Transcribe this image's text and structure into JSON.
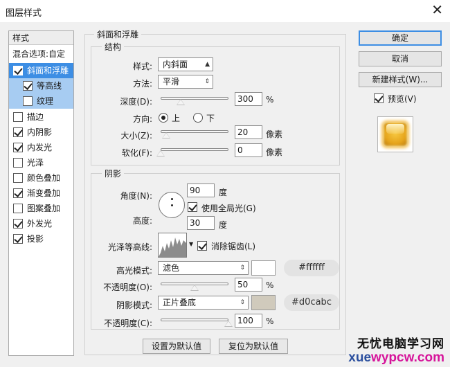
{
  "window": {
    "title": "图层样式",
    "close_glyph": "✕"
  },
  "left_panel": {
    "header": "样式",
    "blend_options": "混合选项:自定",
    "items": [
      {
        "label": "斜面和浮雕",
        "checked": true
      },
      {
        "label": "等高线",
        "checked": true
      },
      {
        "label": "纹理",
        "checked": false
      },
      {
        "label": "描边",
        "checked": false
      },
      {
        "label": "内阴影",
        "checked": true
      },
      {
        "label": "内发光",
        "checked": true
      },
      {
        "label": "光泽",
        "checked": false
      },
      {
        "label": "颜色叠加",
        "checked": false
      },
      {
        "label": "渐变叠加",
        "checked": true
      },
      {
        "label": "图案叠加",
        "checked": false
      },
      {
        "label": "外发光",
        "checked": true
      },
      {
        "label": "投影",
        "checked": true
      }
    ]
  },
  "bevel": {
    "group_title": "斜面和浮雕",
    "structure": {
      "title": "结构",
      "style_label": "样式:",
      "style_value": "内斜面",
      "technique_label": "方法:",
      "technique_value": "平滑",
      "depth_label": "深度(D):",
      "depth_value": "300",
      "depth_unit": "%",
      "direction_label": "方向:",
      "direction_up": "上",
      "direction_down": "下",
      "size_label": "大小(Z):",
      "size_value": "20",
      "size_unit": "像素",
      "soften_label": "软化(F):",
      "soften_value": "0",
      "soften_unit": "像素"
    },
    "shading": {
      "title": "阴影",
      "angle_label": "角度(N):",
      "angle_value": "90",
      "angle_unit": "度",
      "global_light_label": "使用全局光(G)",
      "altitude_label": "高度:",
      "altitude_value": "30",
      "altitude_unit": "度",
      "gloss_contour_label": "光泽等高线:",
      "antialias_label": "消除锯齿(L)",
      "highlight_mode_label": "高光模式:",
      "highlight_mode_value": "滤色",
      "highlight_color": "#ffffff",
      "highlight_hex": "#ffffff",
      "highlight_opacity_label": "不透明度(O):",
      "highlight_opacity_value": "50",
      "highlight_opacity_unit": "%",
      "shadow_mode_label": "阴影模式:",
      "shadow_mode_value": "正片叠底",
      "shadow_color": "#d0cabc",
      "shadow_hex": "#d0cabc",
      "shadow_opacity_label": "不透明度(C):",
      "shadow_opacity_value": "100",
      "shadow_opacity_unit": "%"
    },
    "make_default": "设置为默认值",
    "reset_default": "复位为默认值"
  },
  "sliders": {
    "depth": 0.3,
    "size": 0.08,
    "soften": 0.0,
    "highlight_opacity": 0.5,
    "shadow_opacity": 1.0
  },
  "buttons": {
    "ok": "确定",
    "cancel": "取消",
    "new_style": "新建样式(W)...",
    "preview_label": "预览(V)"
  },
  "watermark": {
    "line1": "无忧电脑学习网",
    "line2_a": "xue",
    "line2_b": "wypcw.com"
  }
}
